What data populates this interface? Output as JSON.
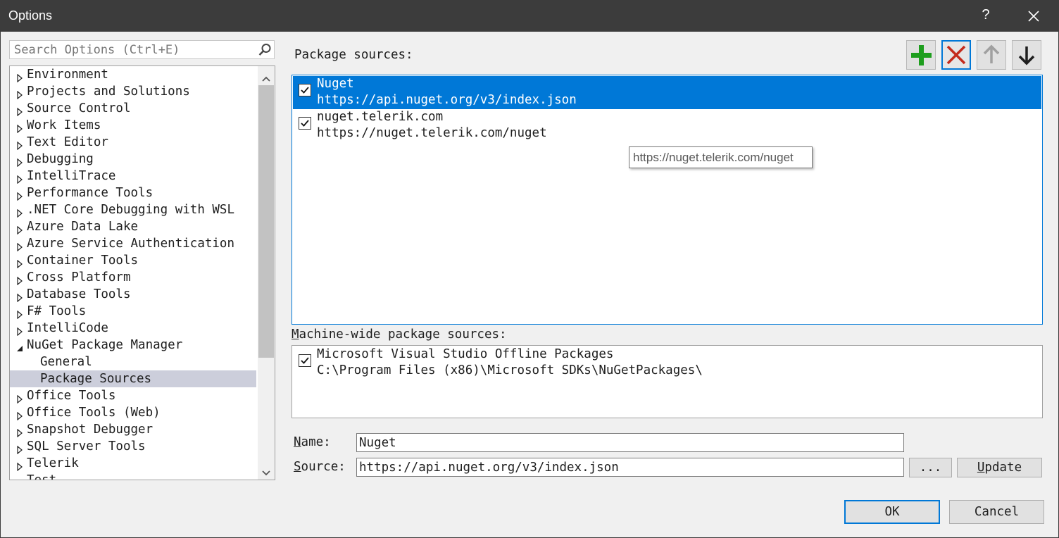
{
  "window": {
    "title": "Options",
    "help_label": "?"
  },
  "search": {
    "placeholder": "Search Options (Ctrl+E)",
    "icon": "search-icon"
  },
  "tree": {
    "items": [
      {
        "label": "Environment",
        "expanded": false
      },
      {
        "label": "Projects and Solutions",
        "expanded": false
      },
      {
        "label": "Source Control",
        "expanded": false
      },
      {
        "label": "Work Items",
        "expanded": false
      },
      {
        "label": "Text Editor",
        "expanded": false
      },
      {
        "label": "Debugging",
        "expanded": false
      },
      {
        "label": "IntelliTrace",
        "expanded": false
      },
      {
        "label": "Performance Tools",
        "expanded": false
      },
      {
        "label": ".NET Core Debugging with WSL",
        "expanded": false
      },
      {
        "label": "Azure Data Lake",
        "expanded": false
      },
      {
        "label": "Azure Service Authentication",
        "expanded": false
      },
      {
        "label": "Container Tools",
        "expanded": false
      },
      {
        "label": "Cross Platform",
        "expanded": false
      },
      {
        "label": "Database Tools",
        "expanded": false
      },
      {
        "label": "F# Tools",
        "expanded": false
      },
      {
        "label": "IntelliCode",
        "expanded": false
      },
      {
        "label": "NuGet Package Manager",
        "expanded": true
      },
      {
        "label": "General",
        "child": true
      },
      {
        "label": "Package Sources",
        "child": true,
        "selected": true
      },
      {
        "label": "Office Tools",
        "expanded": false
      },
      {
        "label": "Office Tools (Web)",
        "expanded": false
      },
      {
        "label": "Snapshot Debugger",
        "expanded": false
      },
      {
        "label": "SQL Server Tools",
        "expanded": false
      },
      {
        "label": "Telerik",
        "expanded": false
      },
      {
        "label": "Test",
        "expanded": false
      }
    ]
  },
  "package_sources": {
    "label": "Package sources:",
    "toolbar": {
      "add": "add-icon",
      "remove": "remove-icon",
      "move_up": "arrow-up-icon",
      "move_down": "arrow-down-icon"
    },
    "items": [
      {
        "name": "Nuget",
        "url": "https://api.nuget.org/v3/index.json",
        "checked": true,
        "selected": true
      },
      {
        "name": "nuget.telerik.com",
        "url": "https://nuget.telerik.com/nuget",
        "checked": true,
        "selected": false
      }
    ],
    "tooltip": "https://nuget.telerik.com/nuget"
  },
  "machine_wide": {
    "label_first": "M",
    "label_rest": "achine-wide package sources:",
    "items": [
      {
        "name": "Microsoft Visual Studio Offline Packages",
        "path": "C:\\Program Files (x86)\\Microsoft SDKs\\NuGetPackages\\",
        "checked": true
      }
    ]
  },
  "form": {
    "name_label_first": "N",
    "name_label_rest": "ame:",
    "name_value": "Nuget",
    "source_label_first": "S",
    "source_label_rest": "ource:",
    "source_value": "https://api.nuget.org/v3/index.json",
    "browse_label": "...",
    "update_label_first": "U",
    "update_label_rest": "pdate"
  },
  "footer": {
    "ok_label": "OK",
    "cancel_label": "Cancel"
  },
  "colors": {
    "accent": "#0078d7",
    "add_green": "#1e9e1e",
    "remove_red": "#c42b1c",
    "titlebar": "#3c3c3c"
  }
}
